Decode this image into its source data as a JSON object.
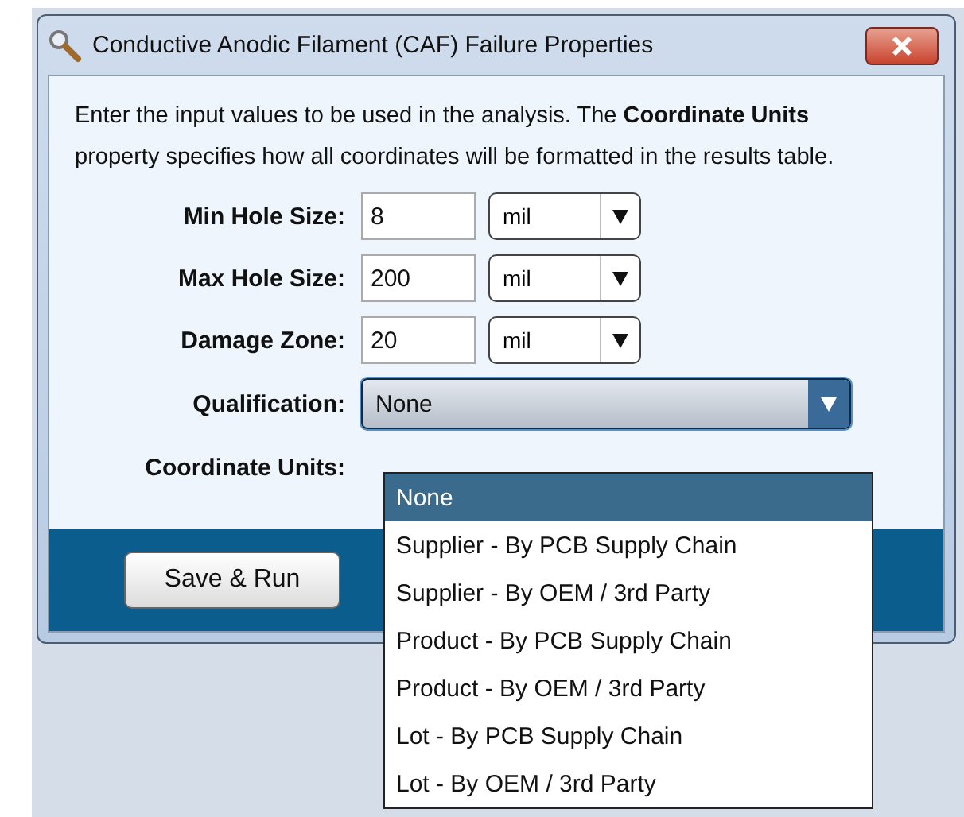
{
  "window": {
    "title": "Conductive Anodic Filament (CAF) Failure Properties"
  },
  "description": "Enter the input values to be used in the analysis. The **Coordinate Units** property specifies how all coordinates will be formatted in the results table.",
  "fields": [
    {
      "label": "Min Hole Size:",
      "value": "8",
      "unit": "mil"
    },
    {
      "label": "Max Hole Size:",
      "value": "200",
      "unit": "mil"
    },
    {
      "label": "Damage Zone:",
      "value": "20",
      "unit": "mil"
    }
  ],
  "qualification": {
    "label": "Qualification:",
    "value": "None",
    "expanded": true,
    "options": [
      {
        "label": "None",
        "selected": true
      },
      {
        "label": "Supplier - By PCB Supply Chain",
        "selected": false
      },
      {
        "label": "Supplier - By OEM / 3rd Party",
        "selected": false
      },
      {
        "label": "Product - By PCB Supply Chain",
        "selected": false
      },
      {
        "label": "Product - By OEM / 3rd Party",
        "selected": false
      },
      {
        "label": "Lot - By PCB Supply Chain",
        "selected": false
      },
      {
        "label": "Lot - By OEM / 3rd Party",
        "selected": false
      }
    ]
  },
  "coordinate_units": {
    "label": "Coordinate Units:"
  },
  "buttons": [
    "Save & Run"
  ]
}
